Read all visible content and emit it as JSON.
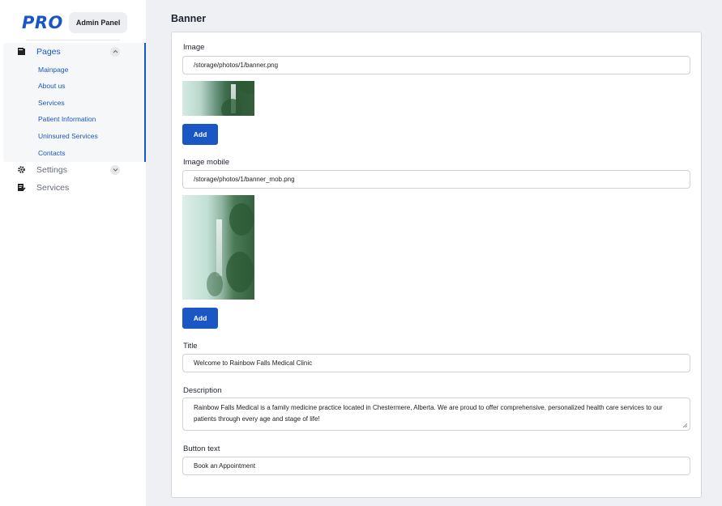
{
  "brand": {
    "logo": "PRO",
    "badge": "Admin Panel"
  },
  "sidebar": {
    "pages": {
      "label": "Pages",
      "children": [
        "Mainpage",
        "About us",
        "Services",
        "Patient Information",
        "Uninsured Services",
        "Contacts"
      ]
    },
    "settings": {
      "label": "Settings"
    },
    "services": {
      "label": "Services"
    }
  },
  "section": {
    "title": "Banner"
  },
  "form": {
    "image": {
      "label": "Image",
      "value": "/storage/photos/1/banner.png",
      "button": "Add"
    },
    "image_mobile": {
      "label": "Image mobile",
      "value": "/storage/photos/1/banner_mob.png",
      "button": "Add"
    },
    "title": {
      "label": "Title",
      "value": "Welcome to Rainbow Falls Medical Clinic"
    },
    "description": {
      "label": "Description",
      "value": "Rainbow Falls Medical is a family medicine practice located in Chestermere, Alberta. We are proud to offer comprehensive, personalized health care services to our patients through every age and stage of life!"
    },
    "button_text": {
      "label": "Button text",
      "value": "Book an Appointment"
    }
  },
  "colors": {
    "accent": "#1a56c4",
    "background": "#eef0f4",
    "sidebar_active_bg": "#f6f7f9"
  },
  "icons": {
    "pages": "document-icon",
    "settings": "gear-icon",
    "services": "edit-document-icon"
  }
}
